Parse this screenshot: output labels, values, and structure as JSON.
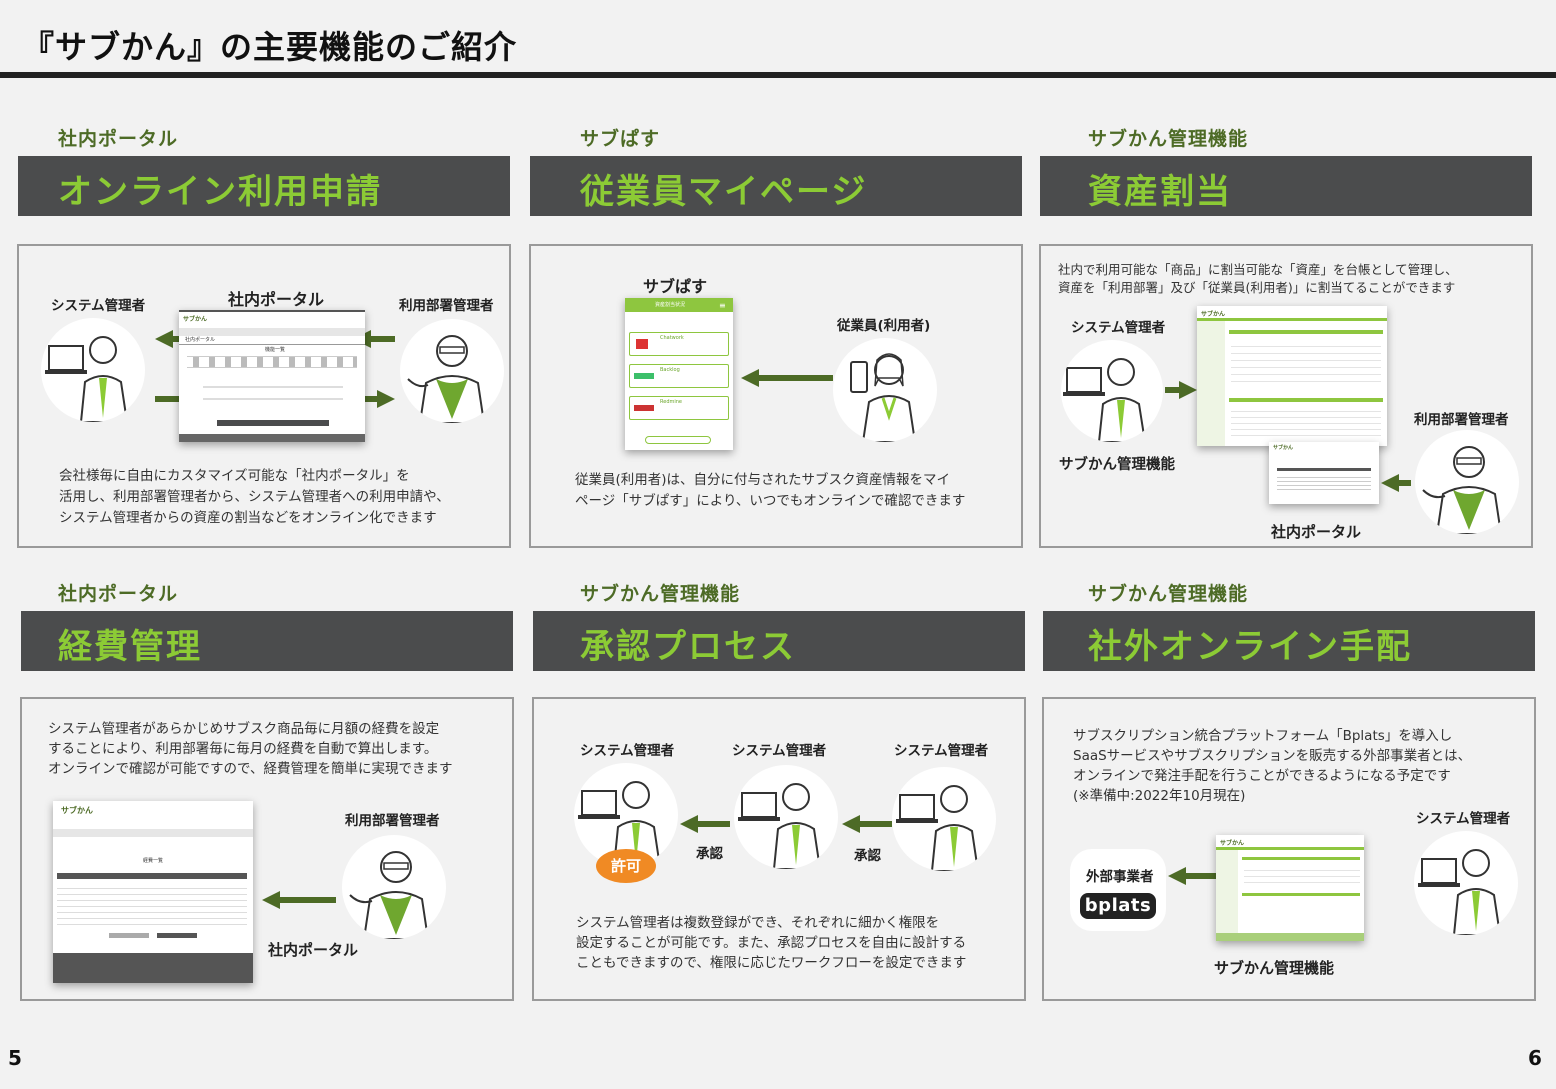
{
  "header": {
    "title": "『サブかん』の主要機能のご紹介"
  },
  "sections": [
    {
      "label": "社内ポータル",
      "title": "オンライン利用申請",
      "description": [
        "会社様毎に自由にカスタマイズ可能な「社内ポータル」を",
        "活用し、利用部署管理者から、システム管理者への利用申請や、",
        "システム管理者からの資産の割当などをオンライン化できます"
      ],
      "diagram": {
        "left_role": "システム管理者",
        "center": "社内ポータル",
        "right_role": "利用部署管理者",
        "mock_title": "社内ポータル",
        "mock_heading": "機能一覧"
      }
    },
    {
      "label": "サブぱす",
      "title": "従業員マイページ",
      "description": [
        "従業員(利用者)は、自分に付与されたサブスク資産情報をマイ",
        "ページ「サブぱす」により、いつでもオンラインで確認できます"
      ],
      "diagram": {
        "phone_label": "サブぱす",
        "user_role": "従業員(利用者)",
        "phone_header": "資産割当状況",
        "services": [
          "Chatwork",
          "Backlog",
          "Redmine"
        ]
      }
    },
    {
      "label": "サブかん管理機能",
      "title": "資産割当",
      "description": [
        "社内で利用可能な「商品」に割当可能な「資産」を台帳として管理し、",
        "資産を「利用部署」及び「従業員(利用者)」に割当てることができます"
      ],
      "diagram": {
        "left_role": "システム管理者",
        "left_caption": "サブかん管理機能",
        "right_role": "利用部署管理者",
        "bottom_caption": "社内ポータル"
      }
    },
    {
      "label": "社内ポータル",
      "title": "経費管理",
      "description": [
        "システム管理者があらかじめサブスク商品毎に月額の経費を設定",
        "することにより、利用部署毎に毎月の経費を自動で算出します。",
        "オンラインで確認が可能ですので、経費管理を簡単に実現できます"
      ],
      "diagram": {
        "right_role": "利用部署管理者",
        "caption": "社内ポータル",
        "mock_heading": "経費一覧"
      }
    },
    {
      "label": "サブかん管理機能",
      "title": "承認プロセス",
      "description": [
        "システム管理者は複数登録ができ、それぞれに細かく権限を",
        "設定することが可能です。また、承認プロセスを自由に設計する",
        "こともできますので、権限に応じたワークフローを設定できます"
      ],
      "diagram": {
        "roles": [
          "システム管理者",
          "システム管理者",
          "システム管理者"
        ],
        "approve_1": "承認",
        "approve_2": "承認",
        "permit": "許可"
      }
    },
    {
      "label": "サブかん管理機能",
      "title": "社外オンライン手配",
      "description": [
        "サブスクリプション統合プラットフォーム「Bplats」を導入し",
        "SaaSサービスやサブスクリプションを販売する外部事業者とは、",
        "オンラインで発注手配を行うことができるようになる予定です",
        "(※準備中:2022年10月現在)"
      ],
      "diagram": {
        "vendor": "外部事業者",
        "vendor_logo": "bplats",
        "right_role": "システム管理者",
        "caption": "サブかん管理機能"
      }
    }
  ],
  "brand": {
    "logo_text": "サブかん"
  },
  "colors": {
    "accent_green": "#8ccb35",
    "dark_green": "#4d6b26",
    "bar_gray": "#4b4c4d",
    "orange": "#f08a24"
  },
  "footer": {
    "page_left": "5",
    "page_right": "6"
  }
}
